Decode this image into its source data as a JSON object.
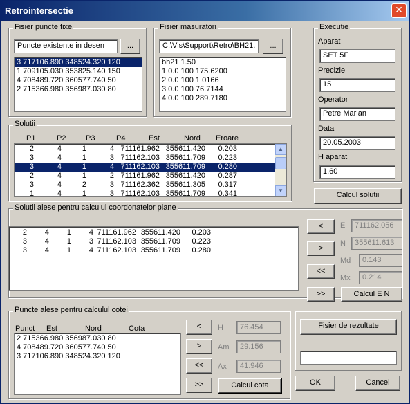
{
  "window": {
    "title": "Retrointersectie",
    "close_symbol": "✕"
  },
  "fisier_puncte": {
    "label": "Fisier puncte fixe",
    "source_value": "Puncte existente in desen",
    "browse_label": "...",
    "items": [
      "3 717106.890 348524.320 120",
      "1 709105.030 353825.140 150",
      "4 708489.720 360577.740 50",
      "2 715366.980 356987.030 80"
    ],
    "selected_index": 0
  },
  "fisier_masuratori": {
    "label": "Fisier masuratori",
    "path_value": "C:\\Vis\\Support\\Retro\\BH21.",
    "browse_label": "...",
    "items": [
      "bh21 1.50",
      "1 0.0 100 175.6200",
      "2 0.0 100 1.0166",
      "3 0.0 100 76.7144",
      "4 0.0 100 289.7180"
    ]
  },
  "executie": {
    "label": "Executie",
    "aparat_label": "Aparat",
    "aparat_value": "SET 5F",
    "precizie_label": "Precizie",
    "precizie_value": "15",
    "operator_label": "Operator",
    "operator_value": "Petre Marian",
    "data_label": "Data",
    "data_value": "20.05.2003",
    "haparat_label": "H aparat",
    "haparat_value": "1.60",
    "calcul_label": "Calcul solutii"
  },
  "solutii": {
    "label": "Solutii",
    "headers": [
      "P1",
      "P2",
      "P3",
      "P4",
      "Est",
      "Nord",
      "Eroare"
    ],
    "rows": [
      [
        "2",
        "4",
        "1",
        "4",
        "711161.962",
        "355611.420",
        "0.203"
      ],
      [
        "3",
        "4",
        "1",
        "3",
        "711162.103",
        "355611.709",
        "0.223"
      ],
      [
        "3",
        "4",
        "1",
        "4",
        "711162.103",
        "355611.709",
        "0.280"
      ],
      [
        "2",
        "4",
        "1",
        "2",
        "711161.962",
        "355611.420",
        "0.287"
      ],
      [
        "3",
        "4",
        "2",
        "3",
        "711162.362",
        "355611.305",
        "0.317"
      ],
      [
        "1",
        "4",
        "1",
        "3",
        "711162.103",
        "355611.709",
        "0.341"
      ]
    ],
    "selected_index": 2
  },
  "solutii_alese": {
    "label": "Solutii alese pentru calculul coordonatelor plane",
    "rows": [
      [
        "2",
        "4",
        "1",
        "4",
        "711161.962",
        "355611.420",
        "0.203"
      ],
      [
        "3",
        "4",
        "1",
        "3",
        "711162.103",
        "355611.709",
        "0.223"
      ],
      [
        "3",
        "4",
        "1",
        "4",
        "711162.103",
        "355611.709",
        "0.280"
      ]
    ],
    "btn_left": "<",
    "btn_right": ">",
    "btn_all_left": "<<",
    "btn_all_right": ">>",
    "e_label": "E",
    "e_value": "711162.056",
    "n_label": "N",
    "n_value": "355611.613",
    "md_label": "Md",
    "md_value": "0.143",
    "mx_label": "Mx",
    "mx_value": "0.214",
    "calcul_label": "Calcul E N"
  },
  "puncte_alese": {
    "label": "Puncte alese pentru calculul cotei",
    "headers": [
      "Punct",
      "Est",
      "Nord",
      "Cota"
    ],
    "items": [
      "2 715366.980 356987.030 80",
      "4 708489.720 360577.740 50",
      "3 717106.890 348524.320 120"
    ],
    "btn_left": "<",
    "btn_right": ">",
    "btn_all_left": "<<",
    "btn_all_right": ">>",
    "h_label": "H",
    "h_value": "76.454",
    "am_label": "Am",
    "am_value": "29.156",
    "ax_label": "Ax",
    "ax_value": "41.946",
    "calcul_label": "Calcul cota"
  },
  "rezultate": {
    "button_label": "Fisier de rezultate",
    "path_value": ""
  },
  "ok_label": "OK",
  "cancel_label": "Cancel"
}
